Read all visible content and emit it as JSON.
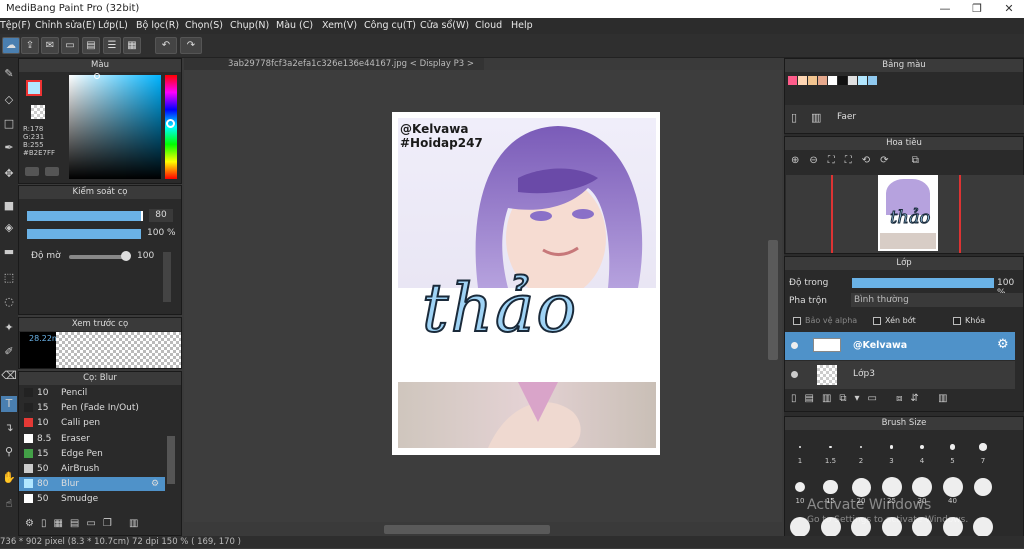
{
  "window": {
    "title": "MediBang Paint Pro (32bit)",
    "minimize": "—",
    "maximize": "❐",
    "close": "✕"
  },
  "menu": [
    "Tệp(F)",
    "Chỉnh sửa(E)",
    "Lớp(L)",
    "Bộ lọc(R)",
    "Chọn(S)",
    "Chụp(N)",
    "Màu (C)",
    "Xem(V)",
    "Công cụ(T)",
    "Cửa sổ(W)",
    "Cloud",
    "Help"
  ],
  "document": {
    "tab": "3ab29778fcf3a2efa1c326e136e44167.jpg < Display P3 >"
  },
  "color_panel": {
    "title": "Màu",
    "r": "R:178",
    "g": "G:231",
    "b": "B:255",
    "hex": "#B2E7FF",
    "fg_color": "#b2e7ff"
  },
  "brush_control": {
    "title": "Kiểm soát cọ",
    "size": "80",
    "opacity": "100 %",
    "density_label": "Độ mờ",
    "density": "100"
  },
  "preview": {
    "title": "Xem trước cọ",
    "value": "28.22m"
  },
  "brush_list": {
    "title": "Cọ: Blur",
    "items": [
      {
        "size": "10",
        "name": "Pencil",
        "color": "#222222"
      },
      {
        "size": "15",
        "name": "Pen (Fade In/Out)",
        "color": "#222222"
      },
      {
        "size": "10",
        "name": "Calli pen",
        "color": "#e53935"
      },
      {
        "size": "8.5",
        "name": "Eraser",
        "color": "#ffffff"
      },
      {
        "size": "15",
        "name": "Edge Pen",
        "color": "#43a047"
      },
      {
        "size": "50",
        "name": "AirBrush",
        "color": "#cccccc"
      },
      {
        "size": "80",
        "name": "Blur",
        "color": "#b2e7ff"
      },
      {
        "size": "50",
        "name": "Smudge",
        "color": "#ffffff"
      }
    ],
    "selected_index": 6
  },
  "artwork": {
    "handle": "@Kelvawa",
    "hashtag": "#Hoidap247",
    "script": "thảo"
  },
  "palette": {
    "title": "Bảng màu",
    "swatches": [
      "#ff5c8a",
      "#ffd6b3",
      "#f2c48f",
      "#e6a88c",
      "#ffffff",
      "#111111",
      "#e0e0e0",
      "#b2e7ff",
      "#8fc9ef"
    ],
    "name": "Faer"
  },
  "navigator": {
    "title": "Hoa tiêu"
  },
  "layer_panel": {
    "title": "Lớp",
    "opacity_label": "Độ trong",
    "opacity": "100 %",
    "blend_label": "Pha trộn",
    "blend": "Bình thường",
    "protect_alpha": "Bảo vệ alpha",
    "clip": "Xén bớt",
    "lock": "Khóa",
    "layers": [
      {
        "name": "@Kelvawa",
        "selected": true
      },
      {
        "name": "Lớp3",
        "selected": false
      }
    ]
  },
  "brush_size": {
    "title": "Brush Size",
    "labels": [
      "1",
      "1.5",
      "2",
      "3",
      "4",
      "5",
      "7",
      "10",
      "15",
      "20",
      "25",
      "30",
      "40"
    ]
  },
  "status": {
    "text": "736 * 902 pixel  (8.3 * 10.7cm)  72 dpi  150 %  ( 169, 170 )"
  },
  "watermark": {
    "line1": "Activate Windows",
    "line2": "Go to Settings to activate Windows."
  }
}
